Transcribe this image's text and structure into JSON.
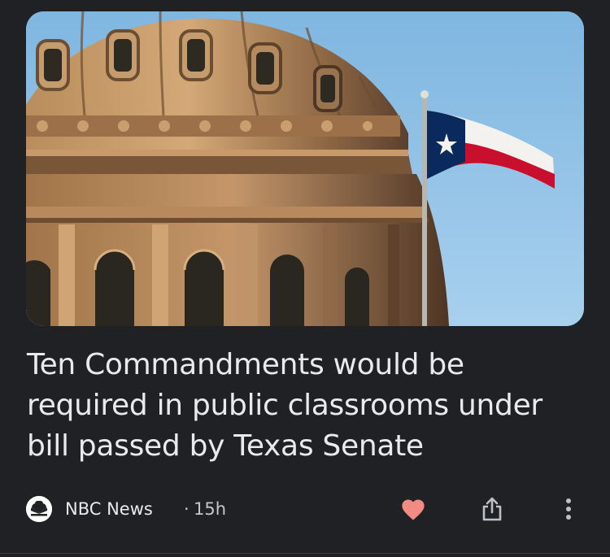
{
  "article": {
    "image_alt": "Texas Capitol dome with Texas flag",
    "headline": "Ten Commandments would be required in public classrooms under bill passed by Texas Senate",
    "source": {
      "name": "NBC News",
      "separator": "·",
      "age": "15h",
      "logo_icon": "nbc-peacock-icon"
    }
  },
  "actions": {
    "like_icon": "heart-icon",
    "share_icon": "share-icon",
    "more_icon": "more-vert-icon"
  },
  "colors": {
    "background": "#202124",
    "headline_text": "#e8eaed",
    "meta_text": "#c4c7c5",
    "heart": "#f28b82",
    "icon": "#bdc1c6",
    "sky": "#8ec0e4",
    "flag_blue": "#0a2a5e",
    "flag_red": "#c8102e"
  }
}
